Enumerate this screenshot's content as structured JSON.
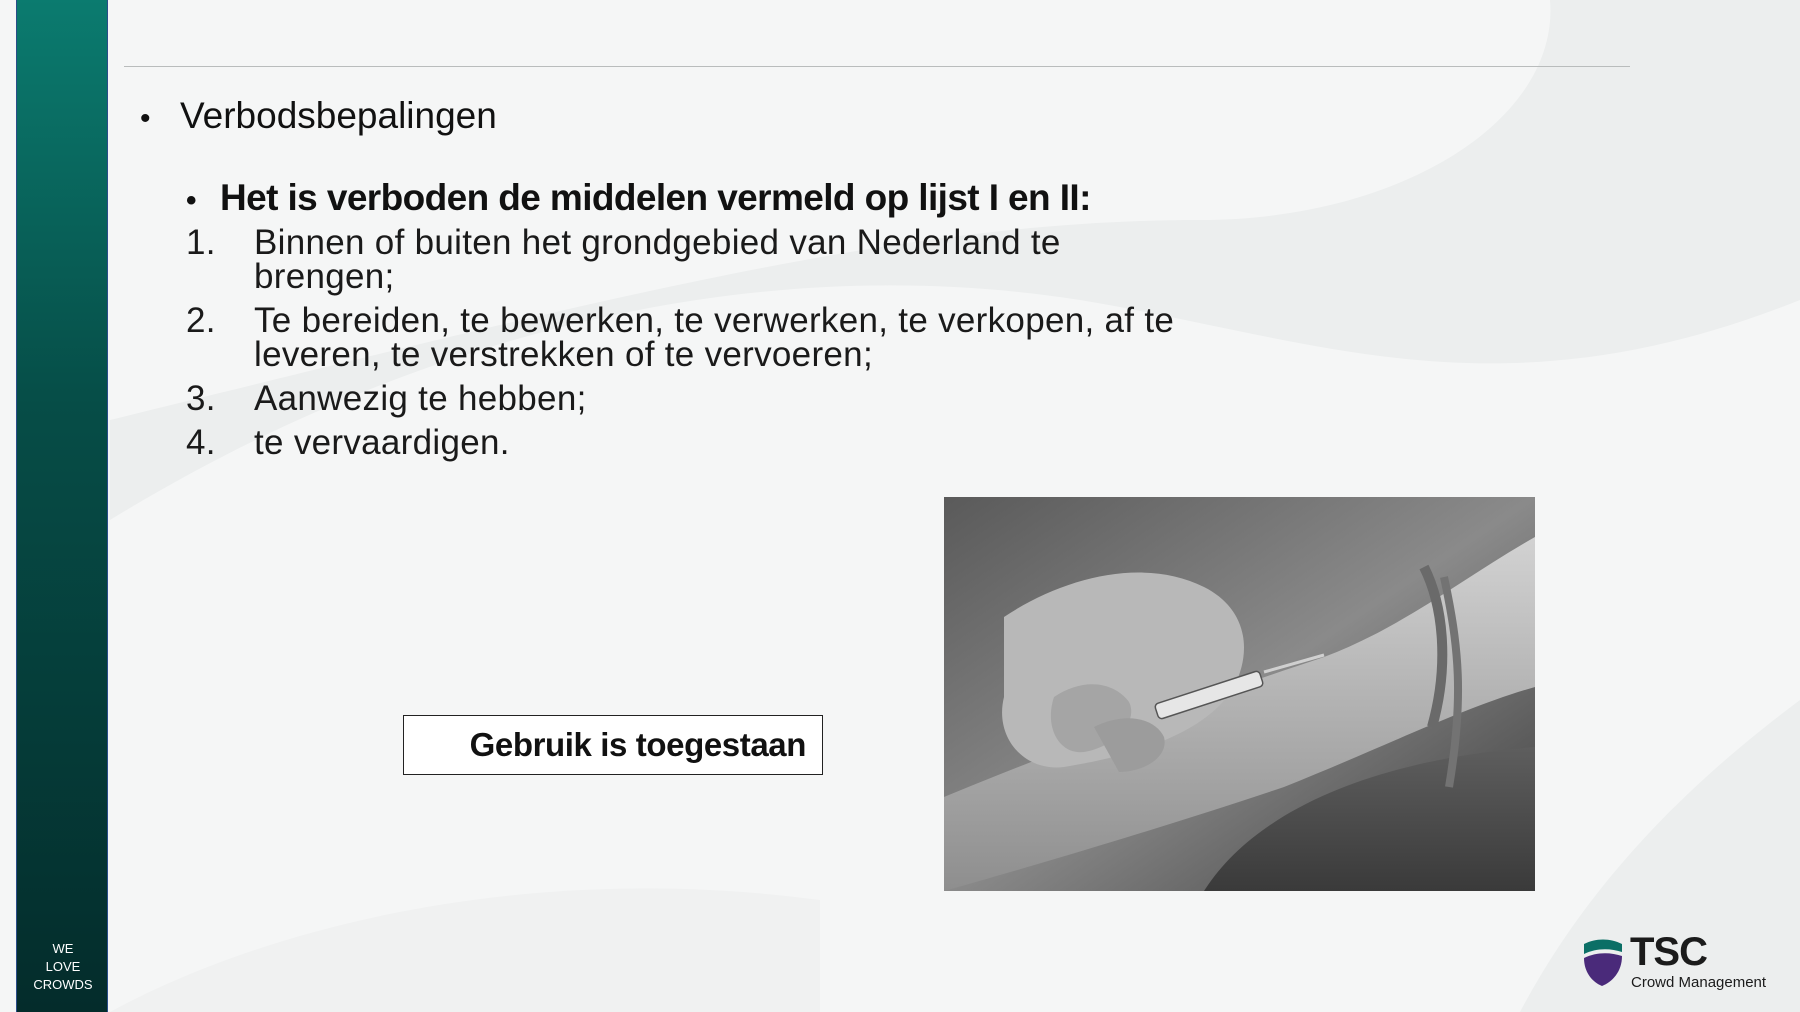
{
  "sidebar": {
    "tagline": [
      "WE",
      "LOVE",
      "CROWDS"
    ]
  },
  "slide": {
    "heading": "Verbodsbepalingen",
    "subheading": "Het is verboden de middelen vermeld op lijst I en II:",
    "items": [
      {
        "num": "1.",
        "text": "Binnen of buiten het grondgebied van Nederland te brengen;"
      },
      {
        "num": "2.",
        "text": "Te bereiden, te bewerken, te verwerken, te verkopen, af te leveren, te verstrekken of te vervoeren;"
      },
      {
        "num": "3.",
        "text": "Aanwezig te hebben;"
      },
      {
        "num": "4.",
        "text": "te vervaardigen."
      }
    ],
    "callout": "Gebruik is toegestaan"
  },
  "logo": {
    "name": "TSC",
    "subtitle": "Crowd Management",
    "colors": {
      "teal": "#0b6f66",
      "purple": "#4a2a7a"
    }
  },
  "theme": {
    "sidebar_top": "#0b7b6f",
    "sidebar_bottom": "#042c2b",
    "background": "#f5f6f6"
  }
}
